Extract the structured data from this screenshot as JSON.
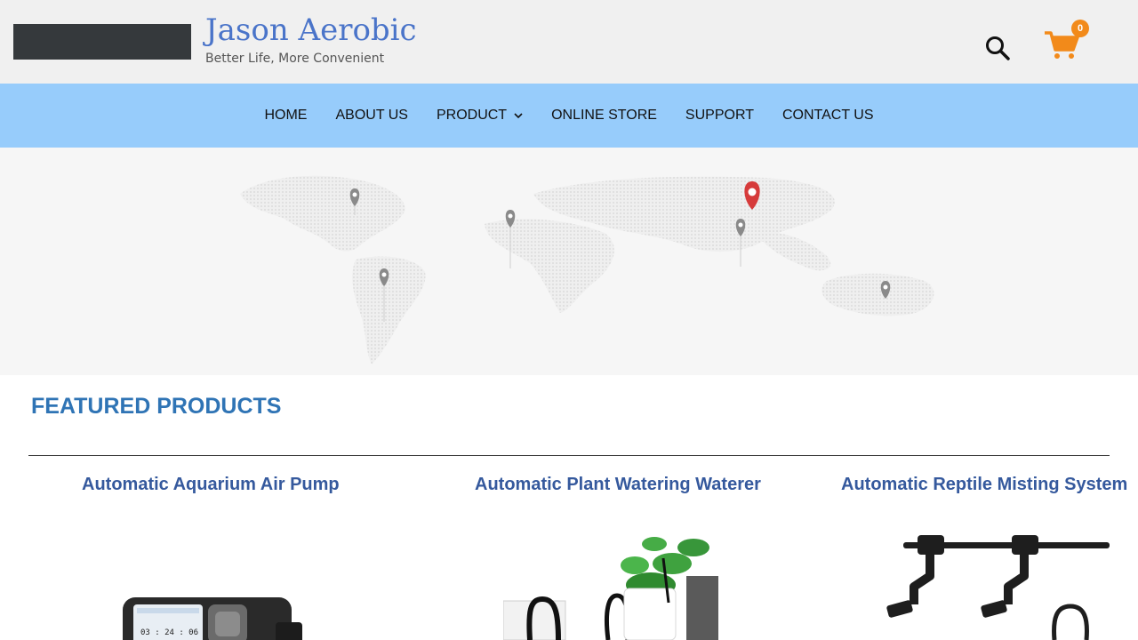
{
  "header": {
    "site_title": "Jason Aerobic",
    "tagline": "Better Life, More Convenient",
    "cart_count": "0",
    "icons": {
      "search": "search-icon",
      "cart": "cart-icon"
    },
    "colors": {
      "title": "#4a74c9",
      "cart": "#f28a1a",
      "topbar": "#f0f0f0"
    }
  },
  "nav": {
    "background": "#97ccfb",
    "items": [
      {
        "label": "HOME"
      },
      {
        "label": "ABOUT US"
      },
      {
        "label": "PRODUCT"
      },
      {
        "label": "ONLINE STORE"
      },
      {
        "label": "SUPPORT"
      },
      {
        "label": "CONTACT US"
      }
    ]
  },
  "hero": {
    "image": "world-map-with-location-pins"
  },
  "featured": {
    "title": "FEATURED PRODUCTS",
    "title_color": "#2f74b5",
    "products": [
      {
        "name": "Automatic Aquarium Air Pump",
        "image": "air-pump-device"
      },
      {
        "name": "Automatic Plant Watering Waterer",
        "image": "plant-watering-kit"
      },
      {
        "name": "Automatic Reptile Misting System",
        "image": "misting-nozzles"
      }
    ],
    "air_pump_display": "03 : 24 : 06"
  }
}
